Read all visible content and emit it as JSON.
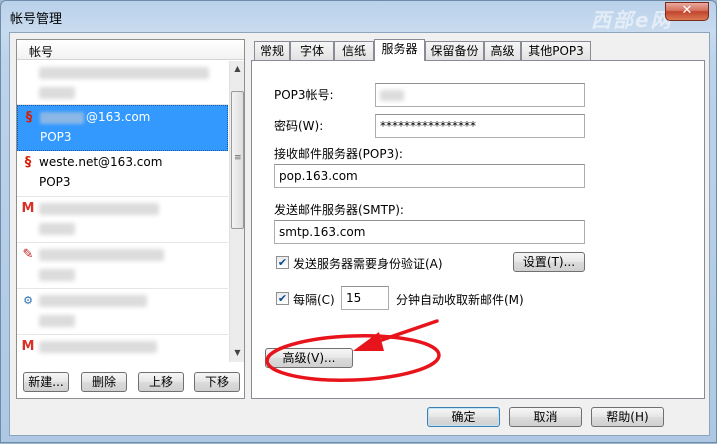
{
  "window": {
    "title": "帐号管理",
    "watermark": "西部e网",
    "close_glyph": "✕"
  },
  "accounts": {
    "header": "帐号",
    "items": [
      {
        "email": "",
        "type": "",
        "icon": ""
      },
      {
        "email_prefix_hidden": true,
        "email": "@163.com",
        "type": "POP3",
        "icon": "163-icon"
      },
      {
        "email": "weste.net@163.com",
        "type": "POP3",
        "icon": "163-icon"
      },
      {
        "email": "",
        "type": "",
        "icon": "gmail-icon"
      },
      {
        "email": "",
        "type": "",
        "icon": "feather-icon"
      },
      {
        "email": "",
        "type": "",
        "icon": "exchange-icon"
      },
      {
        "email": "",
        "type": "",
        "icon": "gmail-icon"
      }
    ],
    "buttons": {
      "new": "新建...",
      "delete": "删除",
      "up": "上移",
      "down": "下移"
    }
  },
  "tabs": [
    "常规",
    "字体",
    "信纸",
    "服务器",
    "保留备份",
    "高级",
    "其他POP3"
  ],
  "active_tab": "服务器",
  "server": {
    "pop3_account_label": "POP3帐号:",
    "password_label": "密码(W):",
    "password_value": "****************",
    "incoming_label": "接收邮件服务器(POP3):",
    "incoming_value": "pop.163.com",
    "outgoing_label": "发送邮件服务器(SMTP):",
    "outgoing_value": "smtp.163.com",
    "auth_check_label": "发送服务器需要身份验证(A)",
    "auth_checked": true,
    "settings_button": "设置(T)...",
    "interval_check_label": "每隔(C)",
    "interval_checked": true,
    "interval_value": "15",
    "interval_suffix": "分钟自动收取新邮件(M)",
    "advanced_button": "高级(V)..."
  },
  "footer": {
    "ok": "确定",
    "cancel": "取消",
    "help": "帮助(H)"
  },
  "colors": {
    "selection": "#3399ff",
    "annotation": "#e8141b",
    "tab_active": "#ffffff"
  }
}
